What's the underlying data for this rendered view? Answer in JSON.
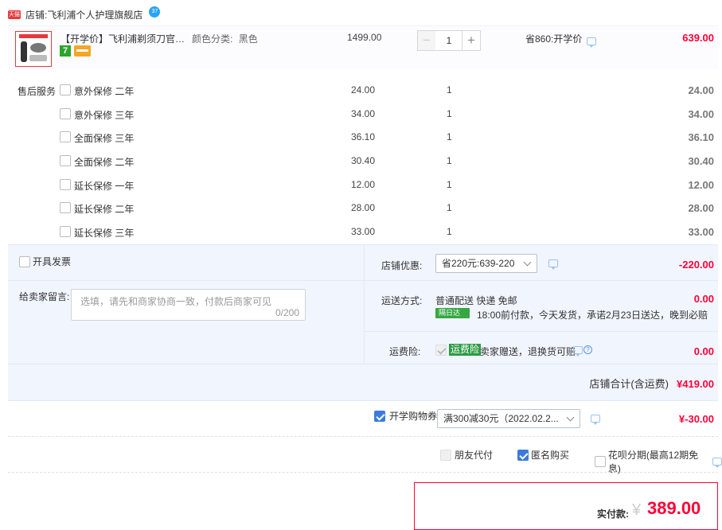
{
  "store": {
    "tag": "天猫",
    "label": "店铺:",
    "name": "飞利浦个人护理旗舰店",
    "badge": "37"
  },
  "item": {
    "title": "【开学价】飞利浦剃须刀官方旗...",
    "sku_label": "颜色分类:",
    "sku_value": "黑色",
    "badge_num": "7",
    "unit_price": "1499.00",
    "qty": "1",
    "qty_minus": "−",
    "qty_plus": "+",
    "promo": "省860:开学价",
    "subtotal": "639.00"
  },
  "service": {
    "title": "售后服务",
    "items": [
      {
        "name": "意外保修 二年",
        "price": "24.00",
        "qty": "1",
        "sum": "24.00"
      },
      {
        "name": "意外保修 三年",
        "price": "34.00",
        "qty": "1",
        "sum": "34.00"
      },
      {
        "name": "全面保修 三年",
        "price": "36.10",
        "qty": "1",
        "sum": "36.10"
      },
      {
        "name": "全面保修 二年",
        "price": "30.40",
        "qty": "1",
        "sum": "30.40"
      },
      {
        "name": "延长保修 一年",
        "price": "12.00",
        "qty": "1",
        "sum": "12.00"
      },
      {
        "name": "延长保修 二年",
        "price": "28.00",
        "qty": "1",
        "sum": "28.00"
      },
      {
        "name": "延长保修 三年",
        "price": "33.00",
        "qty": "1",
        "sum": "33.00"
      }
    ]
  },
  "options": {
    "invoice_label": "开具发票",
    "message_label": "给卖家留言:",
    "message_placeholder": "选填，请先和商家协商一致，付款后商家可见",
    "message_count": "0/200",
    "discount_label": "店铺优惠:",
    "discount_value": "省220元:639-220",
    "discount_amount": "-220.00",
    "shipping_label": "运送方式:",
    "shipping_value": "普通配送 快递 免邮",
    "shipping_fee": "0.00",
    "next_day_tag": "隔日达",
    "shipping_note": "18:00前付款，今天发货，承诺2月23日送达，晚到必赔",
    "insurance_label": "运费险:",
    "insurance_tag": "运费险",
    "insurance_text": "卖家赠送，退换货可赔",
    "insurance_fee": "0.00",
    "store_total_label": "店铺合计(含运费)",
    "store_total": "¥419.00"
  },
  "coupon": {
    "label": "开学购物券",
    "value": "满300减30元（2022.02.2...",
    "amount": "¥-30.00"
  },
  "payment": {
    "friend_pay": "朋友代付",
    "anonymous": "匿名购买",
    "huabei": "花呗分期(最高12期免息)"
  },
  "final": {
    "label": "实付款:",
    "yen": "¥",
    "amount": "389.00"
  },
  "colors": {
    "price_red": "#ff0036",
    "brand_blue": "#3c7bdc",
    "panel_bg": "#f1f5fd"
  }
}
